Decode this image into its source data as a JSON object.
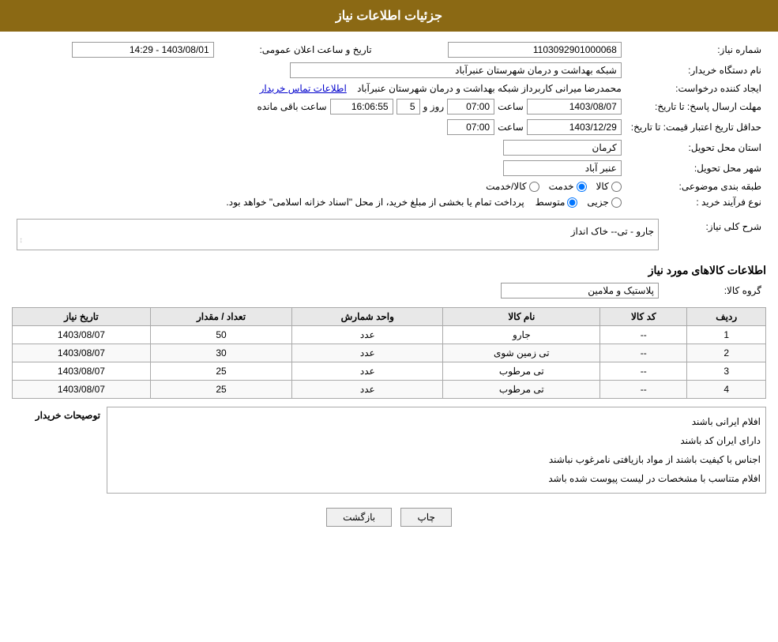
{
  "header": {
    "title": "جزئیات اطلاعات نیاز"
  },
  "fields": {
    "need_number_label": "شماره نیاز:",
    "need_number_value": "1103092901000068",
    "buyer_org_label": "نام دستگاه خریدار:",
    "buyer_org_value": "شبکه بهداشت و درمان شهرستان عنبرآباد",
    "announce_date_label": "تاریخ و ساعت اعلان عمومی:",
    "announce_date_value": "1403/08/01 - 14:29",
    "creator_label": "ایجاد کننده درخواست:",
    "creator_value": "محمدرضا میرانی کاربرداز  شبکه بهداشت و درمان شهرستان عنبرآباد",
    "contact_link": "اطلاعات تماس خریدار",
    "reply_deadline_label": "مهلت ارسال پاسخ: تا تاریخ:",
    "reply_date_value": "1403/08/07",
    "reply_time_label": "ساعت",
    "reply_time_value": "07:00",
    "reply_day_label": "روز و",
    "reply_days_value": "5",
    "reply_remaining_label": "ساعت باقی مانده",
    "reply_remaining_value": "16:06:55",
    "price_deadline_label": "حداقل تاریخ اعتبار قیمت: تا تاریخ:",
    "price_date_value": "1403/12/29",
    "price_time_label": "ساعت",
    "price_time_value": "07:00",
    "province_label": "استان محل تحویل:",
    "province_value": "کرمان",
    "city_label": "شهر محل تحویل:",
    "city_value": "عنبر آباد",
    "category_label": "طبقه بندی موضوعی:",
    "category_kala": "کالا",
    "category_khedmat": "خدمت",
    "category_kala_khedmat": "کالا/خدمت",
    "process_label": "نوع فرآیند خرید :",
    "process_jazri": "جزیی",
    "process_motavaset": "متوسط",
    "process_desc": "پرداخت تمام یا بخشی از مبلغ خرید، از محل \"اسناد خزانه اسلامی\" خواهد بود.",
    "description_label": "شرح کلی نیاز:",
    "description_value": "جارو - تی-- خاک انداز",
    "goods_section_title": "اطلاعات کالاهای مورد نیاز",
    "goods_group_label": "گروه کالا:",
    "goods_group_value": "پلاستیک و ملامین",
    "table_headers": {
      "radif": "ردیف",
      "kod_kala": "کد کالا",
      "name_kala": "نام کالا",
      "vahed": "واحد شمارش",
      "tedad": "تعداد / مقدار",
      "tarikh": "تاریخ نیاز"
    },
    "table_rows": [
      {
        "radif": "1",
        "kod": "--",
        "name": "جارو",
        "vahed": "عدد",
        "tedad": "50",
        "tarikh": "1403/08/07"
      },
      {
        "radif": "2",
        "kod": "--",
        "name": "تی زمین شوی",
        "vahed": "عدد",
        "tedad": "30",
        "tarikh": "1403/08/07"
      },
      {
        "radif": "3",
        "kod": "--",
        "name": "تی مرطوب",
        "vahed": "عدد",
        "tedad": "25",
        "tarikh": "1403/08/07"
      },
      {
        "radif": "4",
        "kod": "--",
        "name": "تی مرطوب",
        "vahed": "عدد",
        "tedad": "25",
        "tarikh": "1403/08/07"
      }
    ],
    "buyer_desc_label": "توصیحات خریدار",
    "buyer_desc_lines": [
      "افلام ایرانی باشند",
      "دارای ایران کد باشند",
      "اجناس با کیفیت باشند از مواد بازیافتی نامرغوب نباشند",
      "افلام متناسب با مشخصات در لیست پیوست شده باشد"
    ],
    "btn_print": "چاپ",
    "btn_back": "بازگشت"
  }
}
